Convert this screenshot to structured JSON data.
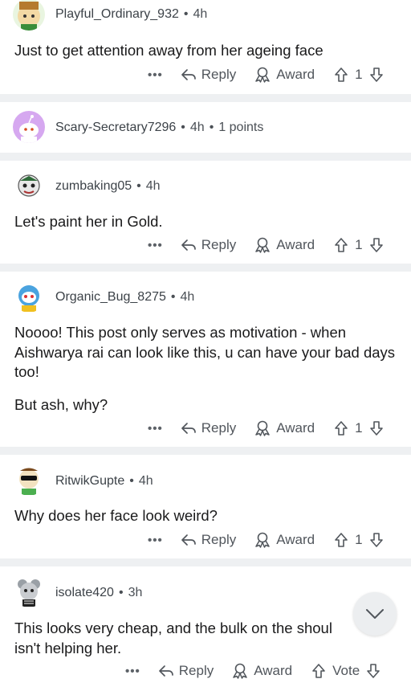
{
  "comments": [
    {
      "username": "Playful_Ordinary_932",
      "time": "4h",
      "body": [
        "Just to get attention away from her ageing face"
      ],
      "actions": {
        "more": "•••",
        "reply": "Reply",
        "award": "Award",
        "votes": "1"
      }
    },
    {
      "username": "Scary-Secretary7296",
      "time": "4h",
      "points": "1 points"
    },
    {
      "username": "zumbaking05",
      "time": "4h",
      "body": [
        "Let's paint her in Gold."
      ],
      "actions": {
        "more": "•••",
        "reply": "Reply",
        "award": "Award",
        "votes": "1"
      }
    },
    {
      "username": "Organic_Bug_8275",
      "time": "4h",
      "body": [
        "Noooo! This post only serves as motivation - when Aishwarya rai can look like this, u can have your bad days too!",
        "But ash, why?"
      ],
      "actions": {
        "more": "•••",
        "reply": "Reply",
        "award": "Award",
        "votes": "1"
      }
    },
    {
      "username": "RitwikGupte",
      "time": "4h",
      "body": [
        "Why does her face look weird?"
      ],
      "actions": {
        "more": "•••",
        "reply": "Reply",
        "award": "Award",
        "votes": "1"
      }
    },
    {
      "username": "isolate420",
      "time": "3h",
      "body": [
        "This looks very cheap, and the bulk on the shoul",
        "isn't helping her."
      ],
      "actions": {
        "more": "•••",
        "reply": "Reply",
        "award": "Award",
        "votes": "Vote"
      }
    }
  ],
  "colors": {
    "separator": "#eef0f2",
    "text": "#1a1a1b",
    "meta": "#4a4f55",
    "snoo_purple": "#d6a8f0"
  },
  "icons": [
    "avatar",
    "reply-arrow-icon",
    "award-icon",
    "upvote-icon",
    "downvote-icon",
    "chevron-down-icon"
  ]
}
